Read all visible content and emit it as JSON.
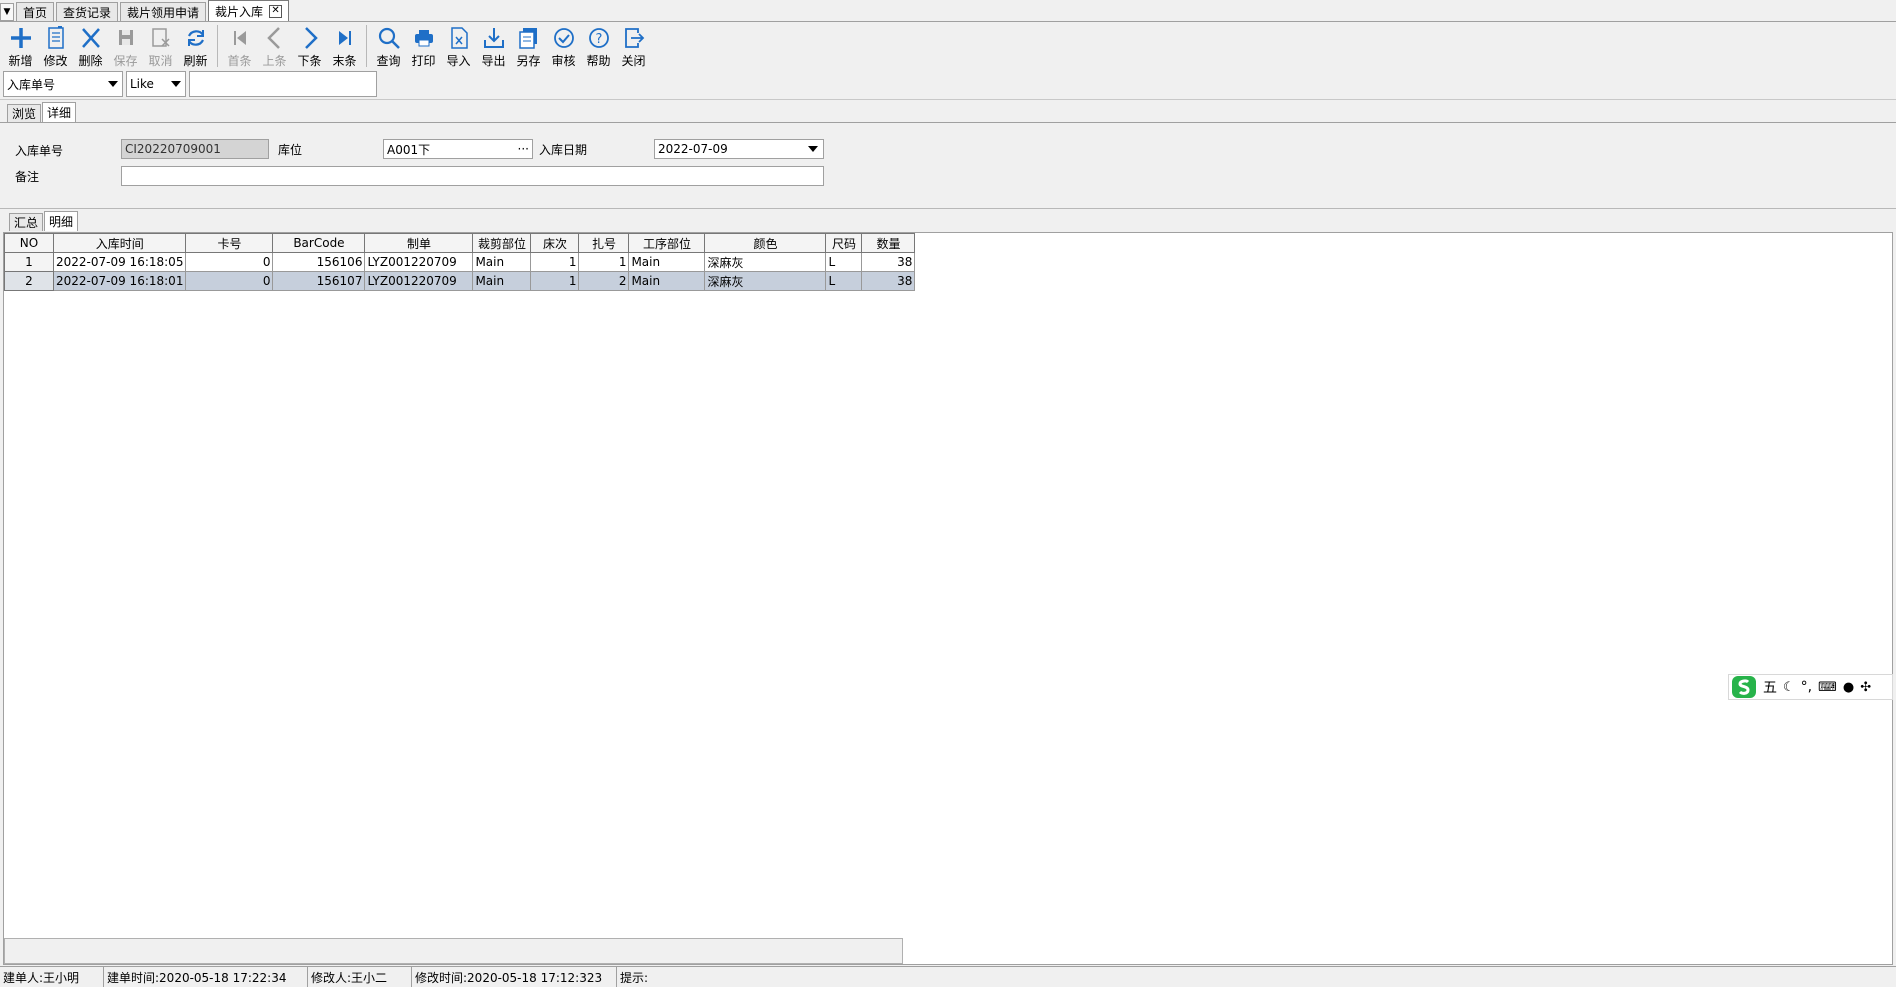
{
  "doc_tabs": {
    "items": [
      "首页",
      "查货记录",
      "裁片领用申请",
      "裁片入库"
    ],
    "close_glyph": "✕"
  },
  "toolbar": {
    "new": "新增",
    "edit": "修改",
    "delete": "删除",
    "save": "保存",
    "cancel": "取消",
    "refresh": "刷新",
    "first": "首条",
    "prev": "上条",
    "next": "下条",
    "last": "末条",
    "query": "查询",
    "print": "打印",
    "import": "导入",
    "export": "导出",
    "save_as": "另存",
    "audit": "审核",
    "help": "帮助",
    "close": "关闭"
  },
  "filter": {
    "field": "入库单号",
    "operator": "Like",
    "value": ""
  },
  "view_tabs": [
    "浏览",
    "详细"
  ],
  "form": {
    "order_no_label": "入库单号",
    "order_no": "CI20220709001",
    "location_label": "库位",
    "location": "A001下",
    "date_label": "入库日期",
    "date": "2022-07-09",
    "remark_label": "备注",
    "remark": ""
  },
  "detail_tabs": [
    "汇总",
    "明细"
  ],
  "grid": {
    "columns": [
      "NO",
      "入库时间",
      "卡号",
      "BarCode",
      "制单",
      "裁剪部位",
      "床次",
      "扎号",
      "工序部位",
      "颜色",
      "尺码",
      "数量"
    ],
    "rows": [
      [
        "1",
        "2022-07-09 16:18:05",
        "0",
        "156106",
        "LYZ001220709",
        "Main",
        "1",
        "1",
        "Main",
        "深麻灰",
        "L",
        "38"
      ],
      [
        "2",
        "2022-07-09 16:18:01",
        "0",
        "156107",
        "LYZ001220709",
        "Main",
        "1",
        "2",
        "Main",
        "深麻灰",
        "L",
        "38"
      ]
    ]
  },
  "ime": {
    "mode": "五",
    "extras": "°,"
  },
  "status": {
    "creator": "建单人:王小明",
    "created_time": "建单时间:2020-05-18 17:22:34",
    "modifier": "修改人:王小二",
    "modified_time": "修改时间:2020-05-18 17:12:323",
    "hint": "提示:"
  },
  "colors": {
    "icon_blue": "#1f6fc7",
    "icon_disabled": "#9a9a9a",
    "selected_row": "#c6cfdc"
  }
}
